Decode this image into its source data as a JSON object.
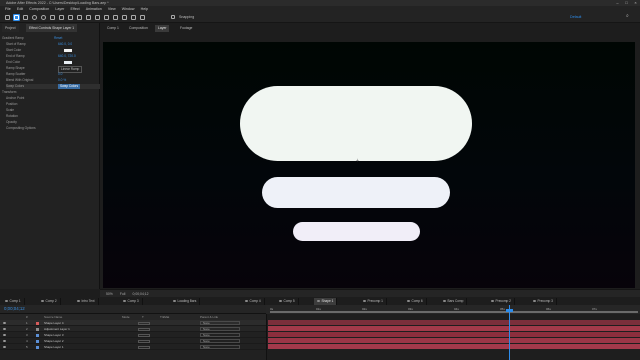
{
  "titlebar": {
    "title": "Adobe After Effects 2022 - C:\\Users\\Desktop\\Loading Bars.aep *"
  },
  "menu": [
    "File",
    "Edit",
    "Composition",
    "Layer",
    "Effect",
    "Animation",
    "View",
    "Window",
    "Help"
  ],
  "toolbar": {
    "workspace": "Default",
    "tools": [
      "home-icon",
      "selection-icon",
      "hand-icon",
      "zoom-icon",
      "orbit-icon",
      "pan-icon",
      "dolly-icon",
      "anchor-icon",
      "rectangle-icon",
      "pen-icon",
      "text-icon",
      "brush-icon",
      "clone-icon",
      "eraser-icon",
      "roto-icon",
      "puppet-icon"
    ]
  },
  "left_panel": {
    "tabs": [
      "Project",
      "Effect Controls Shape Layer 1"
    ],
    "rows": [
      {
        "label": "Gradient Ramp",
        "value": "Reset"
      },
      {
        "label": "Start of Ramp",
        "value": "640.0, 0.0"
      },
      {
        "label": "Start Color",
        "value": ""
      },
      {
        "label": "End of Ramp",
        "value": "640.0, 720.0"
      },
      {
        "label": "End Color",
        "value": ""
      },
      {
        "label": "Ramp Shape",
        "value": "Linear Ramp"
      },
      {
        "label": "Ramp Scatter",
        "value": "0.0"
      },
      {
        "label": "Blend With Original",
        "value": "0.0 %"
      },
      {
        "label": "Swap Colors",
        "value": ""
      },
      {
        "label": "Transform",
        "value": "Reset"
      },
      {
        "label": "Anchor Point",
        "value": ""
      },
      {
        "label": "Position",
        "value": ""
      },
      {
        "label": "Scale",
        "value": ""
      },
      {
        "label": "Rotation",
        "value": ""
      },
      {
        "label": "Opacity",
        "value": ""
      },
      {
        "label": "Compositing Options",
        "value": ""
      }
    ]
  },
  "viewer": {
    "tabs": [
      "Comp 1",
      "Composition",
      "Layer",
      "Footage"
    ],
    "zoom": "50%",
    "resolution": "Full",
    "timecode": "0;00;04;12"
  },
  "timeline": {
    "tabs": [
      "Comp 1",
      "Comp 2",
      "Intro Text",
      "Comp 3",
      "Loading Bars",
      "Comp 4",
      "Comp 5",
      "Shape 1",
      "Precomp 1",
      "Comp 6",
      "Bars Comp",
      "Precomp 2",
      "Precomp 3"
    ],
    "current_time": "0;00;04;12",
    "columns": [
      "#",
      "Source Name",
      "Mode",
      "T",
      "TrkMat",
      "Parent & Link"
    ],
    "layers": [
      {
        "num": "1",
        "name": "Shape Layer 4",
        "label_color": "#d65b5b",
        "parent": "None"
      },
      {
        "num": "2",
        "name": "Adjustment Layer 1",
        "label_color": "#8e8e8e",
        "parent": "None"
      },
      {
        "num": "3",
        "name": "Shape Layer 3",
        "label_color": "#5b8fd6",
        "parent": "None"
      },
      {
        "num": "4",
        "name": "Shape Layer 2",
        "label_color": "#5b8fd6",
        "parent": "None"
      },
      {
        "num": "5",
        "name": "Shape Layer 1",
        "label_color": "#5b8fd6",
        "parent": "None"
      }
    ],
    "ruler_marks": [
      "0s",
      "01s",
      "02s",
      "03s",
      "04s",
      "05s",
      "06s",
      "07s"
    ],
    "playhead_fraction": 0.64,
    "bar_colors": [
      "#7a2f3b",
      "#a23a4a",
      "#8c2e3d",
      "#9b3647",
      "#a3394b"
    ]
  },
  "colors": {
    "accent": "#2d8ceb",
    "pill_fill": "#f1f6f2"
  }
}
